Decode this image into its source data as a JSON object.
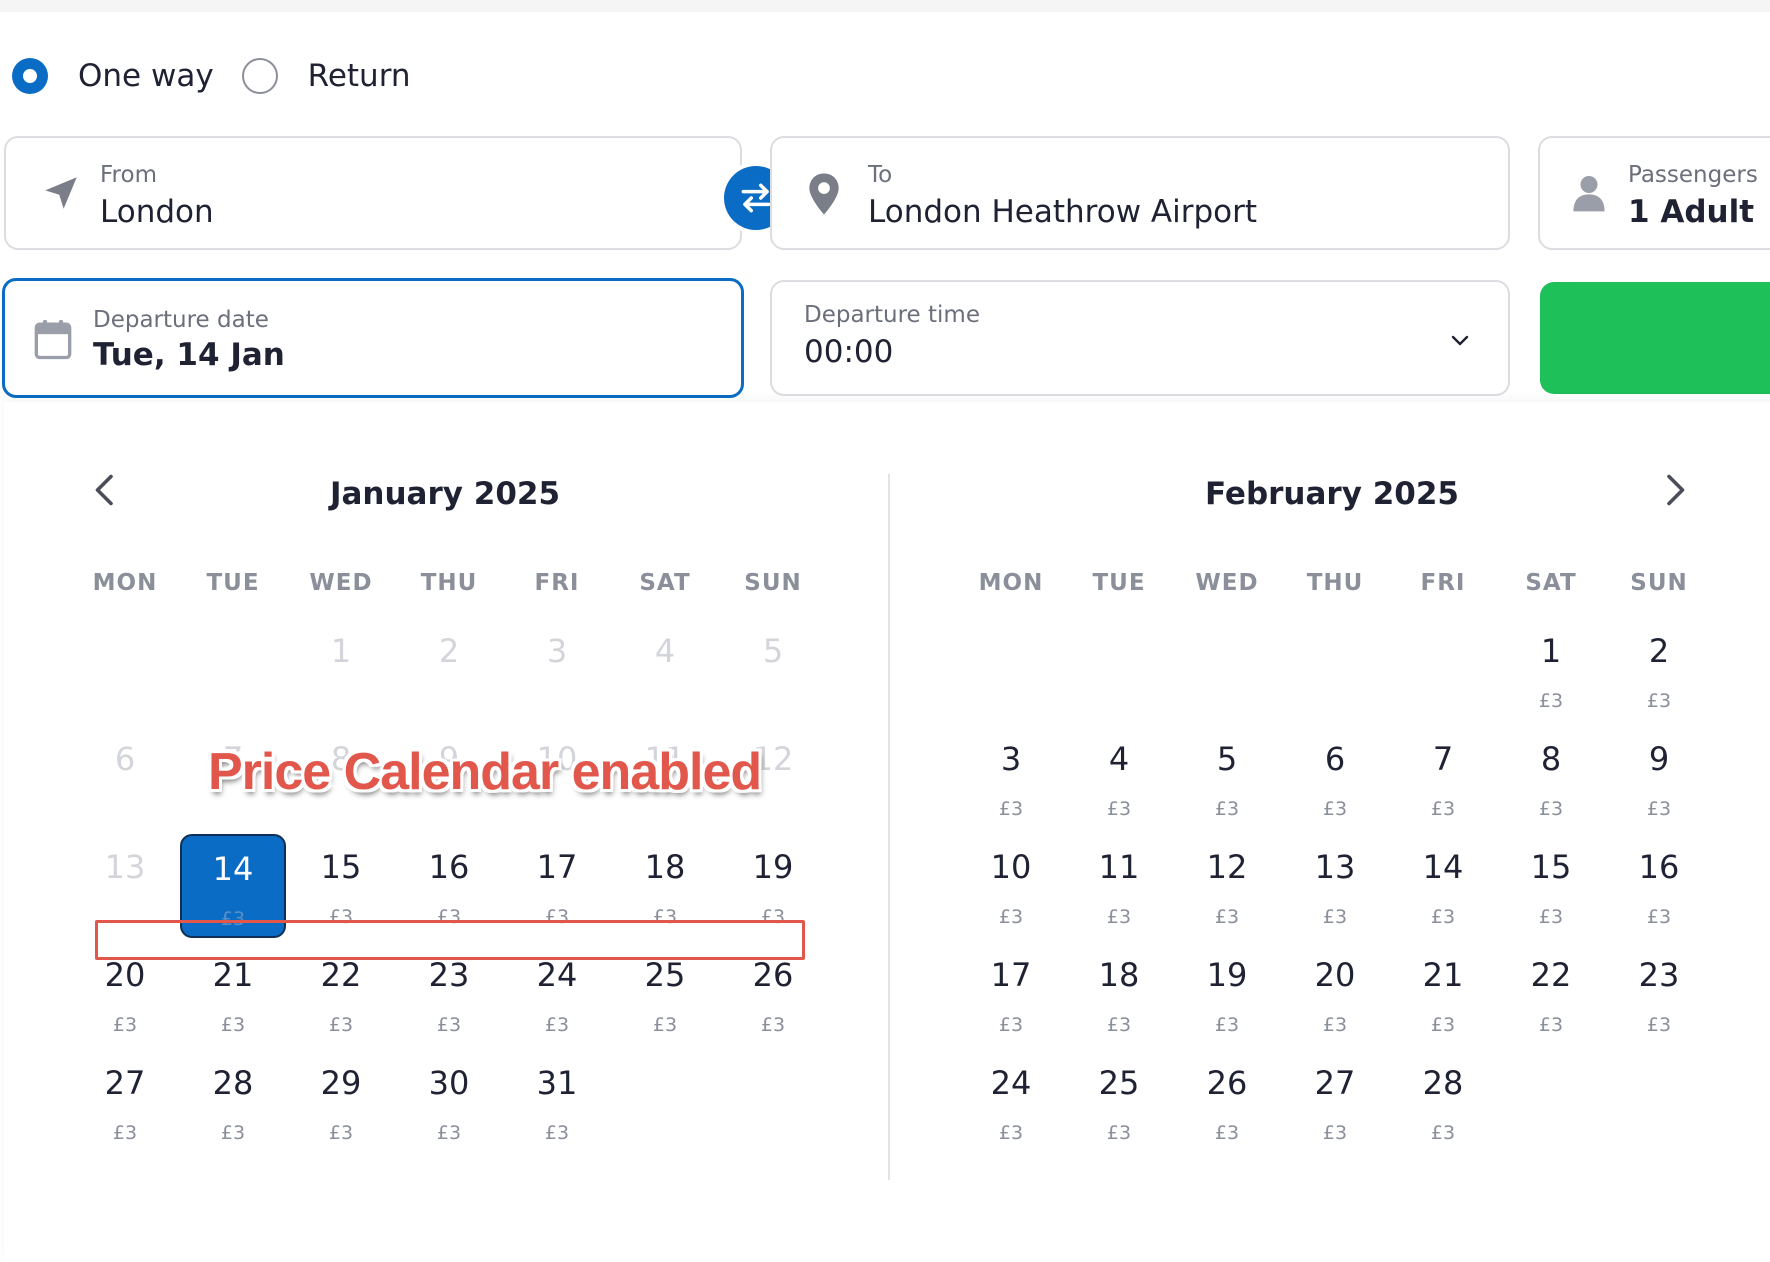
{
  "trip_type": {
    "options": [
      {
        "label": "One way",
        "selected": true
      },
      {
        "label": "Return",
        "selected": false
      }
    ]
  },
  "from_field": {
    "label": "From",
    "value": "London",
    "icon": "navigation-arrow-icon"
  },
  "to_field": {
    "label": "To",
    "value": "London Heathrow Airport",
    "icon": "map-pin-icon"
  },
  "passengers_field": {
    "label": "Passengers",
    "value": "1 Adult",
    "icon": "person-icon"
  },
  "departure_date": {
    "label": "Departure date",
    "value": "Tue, 14 Jan",
    "icon": "calendar-icon"
  },
  "departure_time": {
    "label": "Departure time",
    "value": "00:00",
    "icon": "chevron-down-icon"
  },
  "colors": {
    "accent": "#0a6cc4",
    "search_button": "#1ec05a",
    "annotation": "#e2574c"
  },
  "annotation": {
    "text": "Price Calendar enabled"
  },
  "weekdays": [
    "MON",
    "TUE",
    "WED",
    "THU",
    "FRI",
    "SAT",
    "SUN"
  ],
  "calendar": {
    "months": [
      {
        "title": "January 2025",
        "weeks": [
          [
            null,
            null,
            {
              "d": "1",
              "p": "",
              "muted": true
            },
            {
              "d": "2",
              "p": "",
              "muted": true
            },
            {
              "d": "3",
              "p": "",
              "muted": true
            },
            {
              "d": "4",
              "p": "",
              "muted": true
            },
            {
              "d": "5",
              "p": "",
              "muted": true
            }
          ],
          [
            {
              "d": "6",
              "p": "",
              "muted": true
            },
            {
              "d": "7",
              "p": "",
              "muted": true
            },
            {
              "d": "8",
              "p": "",
              "muted": true
            },
            {
              "d": "9",
              "p": "",
              "muted": true
            },
            {
              "d": "10",
              "p": "",
              "muted": true
            },
            {
              "d": "11",
              "p": "",
              "muted": true
            },
            {
              "d": "12",
              "p": "",
              "muted": true
            }
          ],
          [
            {
              "d": "13",
              "p": "",
              "muted": true
            },
            {
              "d": "14",
              "p": "£3",
              "selected": true
            },
            {
              "d": "15",
              "p": "£3"
            },
            {
              "d": "16",
              "p": "£3"
            },
            {
              "d": "17",
              "p": "£3"
            },
            {
              "d": "18",
              "p": "£3"
            },
            {
              "d": "19",
              "p": "£3"
            }
          ],
          [
            {
              "d": "20",
              "p": "£3"
            },
            {
              "d": "21",
              "p": "£3"
            },
            {
              "d": "22",
              "p": "£3"
            },
            {
              "d": "23",
              "p": "£3"
            },
            {
              "d": "24",
              "p": "£3"
            },
            {
              "d": "25",
              "p": "£3"
            },
            {
              "d": "26",
              "p": "£3"
            }
          ],
          [
            {
              "d": "27",
              "p": "£3"
            },
            {
              "d": "28",
              "p": "£3"
            },
            {
              "d": "29",
              "p": "£3"
            },
            {
              "d": "30",
              "p": "£3"
            },
            {
              "d": "31",
              "p": "£3"
            },
            null,
            null
          ]
        ]
      },
      {
        "title": "February 2025",
        "weeks": [
          [
            null,
            null,
            null,
            null,
            null,
            {
              "d": "1",
              "p": "£3"
            },
            {
              "d": "2",
              "p": "£3"
            }
          ],
          [
            {
              "d": "3",
              "p": "£3"
            },
            {
              "d": "4",
              "p": "£3"
            },
            {
              "d": "5",
              "p": "£3"
            },
            {
              "d": "6",
              "p": "£3"
            },
            {
              "d": "7",
              "p": "£3"
            },
            {
              "d": "8",
              "p": "£3"
            },
            {
              "d": "9",
              "p": "£3"
            }
          ],
          [
            {
              "d": "10",
              "p": "£3"
            },
            {
              "d": "11",
              "p": "£3"
            },
            {
              "d": "12",
              "p": "£3"
            },
            {
              "d": "13",
              "p": "£3"
            },
            {
              "d": "14",
              "p": "£3"
            },
            {
              "d": "15",
              "p": "£3"
            },
            {
              "d": "16",
              "p": "£3"
            }
          ],
          [
            {
              "d": "17",
              "p": "£3"
            },
            {
              "d": "18",
              "p": "£3"
            },
            {
              "d": "19",
              "p": "£3"
            },
            {
              "d": "20",
              "p": "£3"
            },
            {
              "d": "21",
              "p": "£3"
            },
            {
              "d": "22",
              "p": "£3"
            },
            {
              "d": "23",
              "p": "£3"
            }
          ],
          [
            {
              "d": "24",
              "p": "£3"
            },
            {
              "d": "25",
              "p": "£3"
            },
            {
              "d": "26",
              "p": "£3"
            },
            {
              "d": "27",
              "p": "£3"
            },
            {
              "d": "28",
              "p": "£3"
            },
            null,
            null
          ]
        ]
      }
    ]
  }
}
